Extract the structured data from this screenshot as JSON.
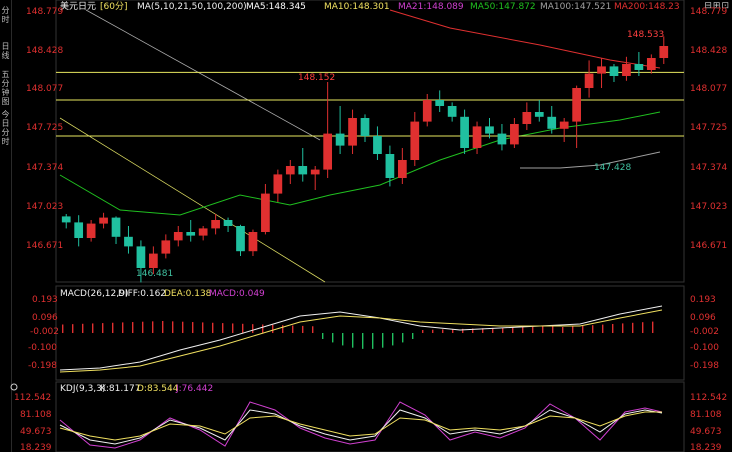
{
  "left_tabs": [
    "分时",
    "日线",
    "五分钟图",
    "今日分时"
  ],
  "window_icons": "⊟⊞⊡",
  "main_panel": {
    "symbol_label": "美元日元",
    "period_label": "[60分]",
    "ma_label": "MA(5,10,21,50,100,200)",
    "ma_values": [
      {
        "text": "MA5:148.345",
        "color": "#ffffff"
      },
      {
        "text": "MA10:148.301",
        "color": "#f0e060"
      },
      {
        "text": "MA21:148.089",
        "color": "#d040d0"
      },
      {
        "text": "MA50:147.872",
        "color": "#20c020"
      },
      {
        "text": "MA100:147.521",
        "color": "#a0a0a0"
      },
      {
        "text": "MA200:148.23",
        "color": "#e03030"
      }
    ],
    "y_ticks": [
      "148.779",
      "148.428",
      "148.077",
      "147.725",
      "147.374",
      "147.023",
      "146.671"
    ],
    "annotations": {
      "high": "148.533",
      "peak": "148.152",
      "low_left": "146.481",
      "low_right": "147.428"
    },
    "horizontal_lines": [
      148.23,
      148.0,
      147.7
    ],
    "down_color": "#20c0a0",
    "up_color": "#e03030"
  },
  "macd_panel": {
    "title": "MACD(26,12,9)",
    "diff_label": "DIFF:0.162",
    "dea_label": "DEA:0.138",
    "macd_label": "MACD:0.049",
    "y_ticks": [
      "0.193",
      "0.096",
      "-0.002",
      "-0.100",
      "-0.198"
    ]
  },
  "kdj_panel": {
    "title": "KDJ(9,3,3)",
    "k_label": "K:81.177",
    "d_label": "D:83.544",
    "j_label": "J:76.442",
    "y_ticks": [
      "112.542",
      "81.108",
      "49.673",
      "18.239"
    ]
  },
  "chart_data": {
    "type": "candlestick",
    "ylim": [
      146.5,
      148.8
    ],
    "candles": [
      [
        147.03,
        147.05,
        146.93,
        146.98
      ],
      [
        146.98,
        147.04,
        146.78,
        146.85
      ],
      [
        146.85,
        147.0,
        146.82,
        146.97
      ],
      [
        146.97,
        147.06,
        146.93,
        147.02
      ],
      [
        147.02,
        147.03,
        146.8,
        146.86
      ],
      [
        146.86,
        146.95,
        146.72,
        146.78
      ],
      [
        146.78,
        146.83,
        146.48,
        146.6
      ],
      [
        146.6,
        146.78,
        146.55,
        146.72
      ],
      [
        146.72,
        146.88,
        146.68,
        146.83
      ],
      [
        146.83,
        146.95,
        146.78,
        146.9
      ],
      [
        146.9,
        147.0,
        146.82,
        146.87
      ],
      [
        146.87,
        146.95,
        146.83,
        146.93
      ],
      [
        146.93,
        147.05,
        146.88,
        147.0
      ],
      [
        147.0,
        147.02,
        146.9,
        146.95
      ],
      [
        146.95,
        146.96,
        146.7,
        146.74
      ],
      [
        146.74,
        146.92,
        146.7,
        146.9
      ],
      [
        146.9,
        147.3,
        146.88,
        147.22
      ],
      [
        147.22,
        147.42,
        147.15,
        147.38
      ],
      [
        147.38,
        147.5,
        147.3,
        147.45
      ],
      [
        147.45,
        147.6,
        147.32,
        147.38
      ],
      [
        147.38,
        147.45,
        147.25,
        147.42
      ],
      [
        147.42,
        148.15,
        147.35,
        147.72
      ],
      [
        147.72,
        147.95,
        147.55,
        147.62
      ],
      [
        147.62,
        147.92,
        147.55,
        147.85
      ],
      [
        147.85,
        147.88,
        147.65,
        147.7
      ],
      [
        147.7,
        147.78,
        147.5,
        147.55
      ],
      [
        147.55,
        147.62,
        147.28,
        147.35
      ],
      [
        147.35,
        147.6,
        147.3,
        147.5
      ],
      [
        147.5,
        147.9,
        147.45,
        147.82
      ],
      [
        147.82,
        148.05,
        147.78,
        148.0
      ],
      [
        148.0,
        148.08,
        147.9,
        147.95
      ],
      [
        147.95,
        147.98,
        147.82,
        147.86
      ],
      [
        147.86,
        147.92,
        147.55,
        147.6
      ],
      [
        147.6,
        147.82,
        147.55,
        147.78
      ],
      [
        147.78,
        147.85,
        147.68,
        147.72
      ],
      [
        147.72,
        147.8,
        147.58,
        147.63
      ],
      [
        147.63,
        147.85,
        147.6,
        147.8
      ],
      [
        147.8,
        147.98,
        147.75,
        147.9
      ],
      [
        147.9,
        148.0,
        147.82,
        147.86
      ],
      [
        147.86,
        147.95,
        147.72,
        147.76
      ],
      [
        147.76,
        147.85,
        147.65,
        147.82
      ],
      [
        147.82,
        148.12,
        147.6,
        148.1
      ],
      [
        148.1,
        148.33,
        148.02,
        148.22
      ],
      [
        148.22,
        148.35,
        148.1,
        148.28
      ],
      [
        148.28,
        148.3,
        148.15,
        148.2
      ],
      [
        148.2,
        148.36,
        148.16,
        148.3
      ],
      [
        148.3,
        148.4,
        148.2,
        148.25
      ],
      [
        148.25,
        148.38,
        148.22,
        148.35
      ],
      [
        148.35,
        148.53,
        148.3,
        148.45
      ]
    ]
  }
}
